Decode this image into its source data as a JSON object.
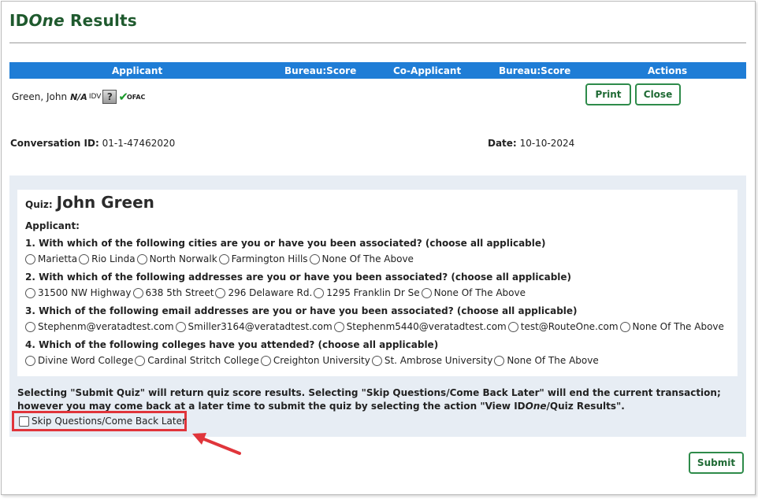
{
  "page": {
    "title_prefix": "ID",
    "title_italic": "One",
    "title_suffix": "Results"
  },
  "table_header": {
    "applicant": "Applicant",
    "bureau_score_1": "Bureau:Score",
    "co_applicant": "Co-Applicant",
    "bureau_score_2": "Bureau:Score",
    "actions": "Actions"
  },
  "applicant": {
    "name": "Green, John",
    "na": "N/A",
    "idv": "IDV",
    "ofac": "OFAC"
  },
  "actions": {
    "print": "Print",
    "close": "Close"
  },
  "conversation": {
    "label": "Conversation ID:",
    "value": "01-1-47462020"
  },
  "date": {
    "label": "Date:",
    "value": "10-10-2024"
  },
  "quiz": {
    "label": "Quiz:",
    "name": "John Green",
    "section": "Applicant:",
    "questions": [
      {
        "text": "1. With which of the following cities are you or have you been associated? (choose all applicable)",
        "options": [
          "Marietta",
          "Rio Linda",
          "North Norwalk",
          "Farmington Hills",
          "None Of The Above"
        ]
      },
      {
        "text": "2. With which of the following addresses are you or have you been associated? (choose all applicable)",
        "options": [
          "31500 NW Highway",
          "638 5th Street",
          "296 Delaware Rd.",
          "1295 Franklin Dr Se",
          "None Of The Above"
        ]
      },
      {
        "text": "3. Which of the following email addresses are you or have you been associated? (choose all applicable)",
        "options": [
          "Stephenm@veratadtest.com",
          "Smiller3164@veratadtest.com",
          "Stephenm5440@veratadtest.com",
          "test@RouteOne.com",
          "None Of The Above"
        ]
      },
      {
        "text": "4. Which of the following colleges have you attended? (choose all applicable)",
        "options": [
          "Divine Word College",
          "Cardinal Stritch College",
          "Creighton University",
          "St. Ambrose University",
          "None Of The Above"
        ]
      }
    ]
  },
  "note": {
    "part1": "Selecting \"Submit Quiz\" will return quiz score results. Selecting \"Skip Questions/Come Back Later\" will end the current transaction; however you may come back at a later time to submit the quiz by selecting the action \"View ID",
    "italic": "One",
    "part2": "/Quiz Results\"."
  },
  "skip": {
    "label": "Skip Questions/Come Back Later"
  },
  "submit": {
    "label": "Submit"
  },
  "colors": {
    "header_blue": "#1f7dd6",
    "title_green": "#1f5a2e",
    "button_green": "#2e8b4a",
    "highlight_red": "#e0353b",
    "panel_bg": "#e7edf4"
  }
}
